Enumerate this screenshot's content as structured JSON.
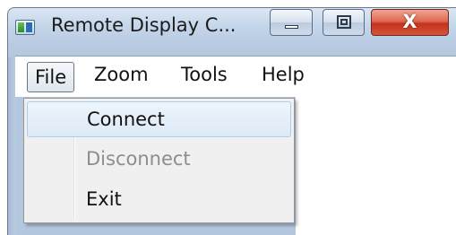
{
  "window": {
    "title": "Remote Display C...",
    "app_icon": "remote-display-app-icon",
    "controls": {
      "minimize_icon": "minimize-icon",
      "maximize_icon": "maximize-icon",
      "close_glyph": "X"
    }
  },
  "menubar": {
    "items": [
      {
        "label": "File",
        "state": "open"
      },
      {
        "label": "Zoom"
      },
      {
        "label": "Tools"
      },
      {
        "label": "Help"
      }
    ]
  },
  "file_menu": {
    "items": [
      {
        "label": "Connect",
        "state": "hover"
      },
      {
        "label": "Disconnect",
        "state": "disabled"
      },
      {
        "label": "Exit"
      }
    ]
  }
}
